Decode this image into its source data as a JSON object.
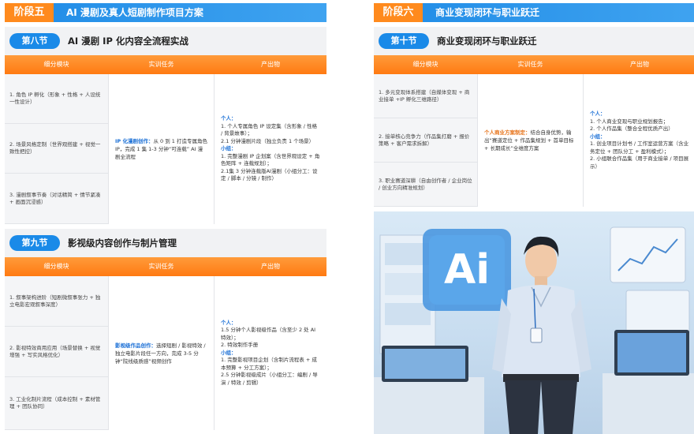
{
  "left": {
    "stage_tag": "阶段五",
    "stage_title": "AI 漫剧及真人短剧制作项目方案",
    "sections": [
      {
        "tag": "第八节",
        "title": "AI 漫剧 IP 化内容全流程实战",
        "headers": [
          "细分模块",
          "实训任务",
          "产出物"
        ],
        "modules": [
          "1. 角色 IP 孵化（形象 + 性格 + 人设统一性设计）",
          "2. 场景风格定制（世界观搭建 + 视觉一致性把控）",
          "3. 漫剧叙事节奏（对话精简 + 情节紧凑 + 画面沉浸感）"
        ],
        "task_highlight": "IP 化漫剧创作：",
        "task_text": "从 0 到 1 打造专属角色 IP，完成 1 集 1-3 分钟“可连载” AI 漫剧全流程",
        "output_lines": [
          {
            "t": "个人：",
            "h": true
          },
          {
            "t": "1. 个人专属角色 IP 设定集（含形象 / 性格 / 背景故事）；",
            "h": false
          },
          {
            "t": "2.1 分钟漫剧片段（独立负责 1 个场景）",
            "h": false
          },
          {
            "t": "小组：",
            "h": true
          },
          {
            "t": "1. 完整漫剧 IP 企划案（含世界观设定 + 角色矩阵 + 连载规划）；",
            "h": false
          },
          {
            "t": "2.1集 3 分钟连载版AI漫剧（小组分工：设定 / 脚本 / 分镜 / 制作）",
            "h": false
          }
        ]
      },
      {
        "tag": "第九节",
        "title": "影视级内容创作与制片管理",
        "headers": [
          "细分模块",
          "实训任务",
          "产出物"
        ],
        "modules": [
          "1. 叙事架构进阶（短剧微叙事张力 + 独立电影宏观叙事深度）",
          "2. 影视特效商用应用（场景替换 + 视觉增强 + 写实风格优化）",
          "3. 工业化制片流程（成本控制 + 素材管理 + 团队协同）"
        ],
        "task_highlight": "影视级作品创作：",
        "task_text": "选择短剧 / 影视特效 / 独立电影片段任一方向，完成 3-5 分钟“院线级质感”视频创作",
        "output_lines": [
          {
            "t": "个人：",
            "h": true
          },
          {
            "t": "1.5 分钟个人影视级作品（含至少 2 处 AI 特效）；",
            "h": false
          },
          {
            "t": "2. 特效制作手册",
            "h": false
          },
          {
            "t": "小组：",
            "h": true
          },
          {
            "t": "1. 完整影视项目企划（含制片流程表 + 成本预算 + 分工方案）；",
            "h": false
          },
          {
            "t": "2.5 分钟影视级成片（小组分工：编剧 / 导演 / 特效 / 剪辑）",
            "h": false
          }
        ]
      }
    ]
  },
  "right": {
    "stage_tag": "阶段六",
    "stage_title": "商业变现闭环与职业跃迁",
    "section": {
      "tag": "第十节",
      "title": "商业变现闭环与职业跃迁",
      "headers": [
        "细分模块",
        "实训任务",
        "产出物"
      ],
      "modules": [
        "1. 多元变现体系搭建（自媒体变现 + 商业接单 +IP 孵化三维路径）",
        "2. 接单核心竞争力（作品集打磨 + 报价策略 + 客户需求拆解）",
        "3. 职业赛道深耕（自由创作者 / 企业岗位 / 创业方向精准规划）"
      ],
      "task_highlight": "个人商业方案制定：",
      "task_text": "结合自身优势，输出“赛道定位 + 作品集规划 + 首单目标 + 长期成长”全维度方案",
      "output_lines": [
        {
          "t": "个人：",
          "h": true
        },
        {
          "t": "1. 个人商业变现与职业规划报告；",
          "h": false
        },
        {
          "t": "2. 个人作品集（整合全程优质产出）",
          "h": false
        },
        {
          "t": "小组：",
          "h": true
        },
        {
          "t": "1. 创业项目计划书 / 工作室运营方案（含业务定位 + 团队分工 + 盈利模式）；",
          "h": false
        },
        {
          "t": "2. 小组联合作品集（用于商业接单 / 项目展示）",
          "h": false
        }
      ]
    },
    "illustration": {
      "logo_text": "Ai"
    }
  }
}
